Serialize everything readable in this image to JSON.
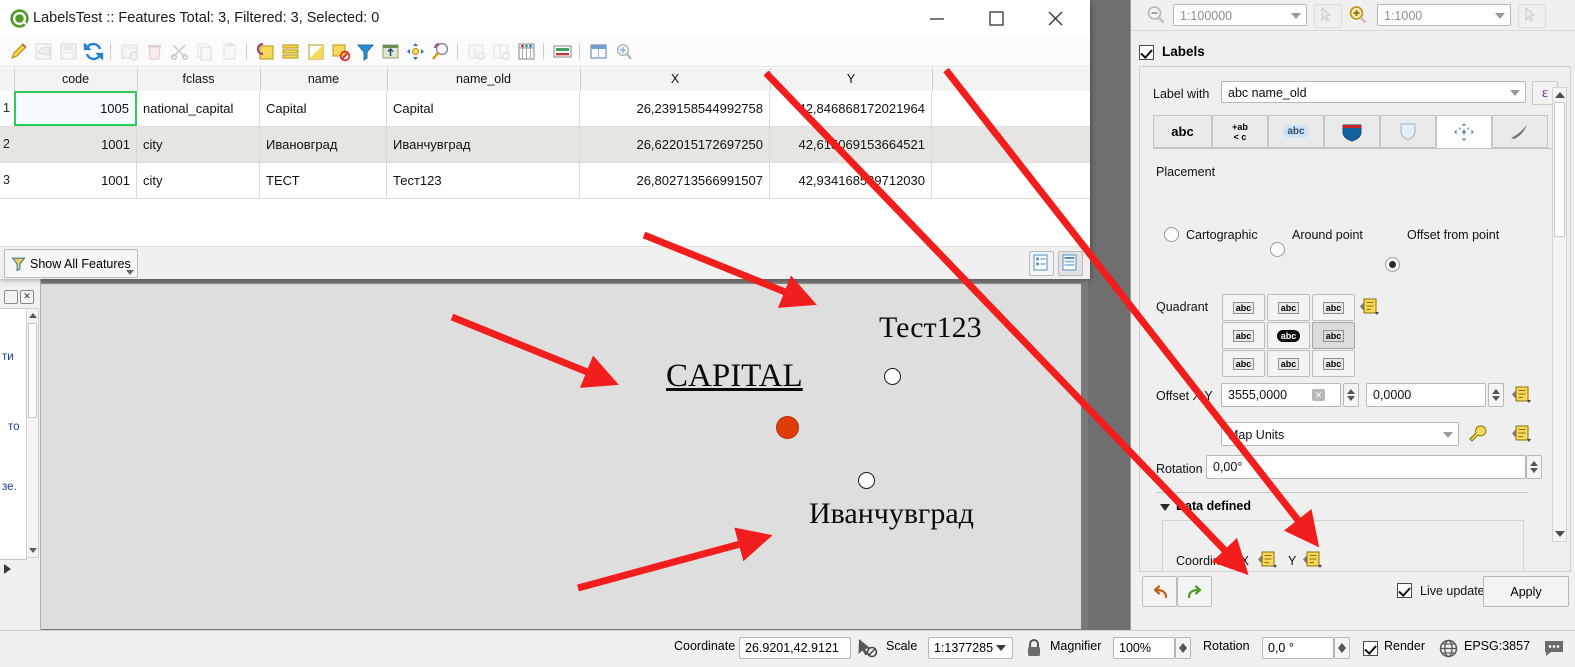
{
  "window": {
    "title": "LabelsTest :: Features Total: 3, Filtered: 3, Selected: 0",
    "minimize_label": "Minimize",
    "maximize_label": "Maximize",
    "close_label": "Close"
  },
  "attribute_toolbar": {
    "buttons": [
      {
        "name": "toggle-editing-icon",
        "title": "Toggle editing mode"
      },
      {
        "name": "save-edits-icon",
        "title": "Save edits"
      },
      {
        "name": "save-layer-edits-icon",
        "title": "Save layer edits"
      },
      {
        "name": "reload-table-icon",
        "title": "Reload the table"
      },
      {
        "name": "add-feature-icon",
        "title": "Add feature"
      },
      {
        "name": "delete-selected-icon",
        "title": "Delete selected features"
      },
      {
        "name": "cut-features-icon",
        "title": "Cut features"
      },
      {
        "name": "copy-features-icon",
        "title": "Copy features"
      },
      {
        "name": "paste-features-icon",
        "title": "Paste features"
      },
      {
        "name": "select-by-expression-icon",
        "title": "Select features using an expression"
      },
      {
        "name": "select-all-icon",
        "title": "Select all"
      },
      {
        "name": "invert-selection-icon",
        "title": "Invert selection"
      },
      {
        "name": "deselect-all-icon",
        "title": "Deselect all"
      },
      {
        "name": "filter-selection-icon",
        "title": "Filter / select using form"
      },
      {
        "name": "move-selection-to-top-icon",
        "title": "Move selection to top"
      },
      {
        "name": "pan-map-to-selected-icon",
        "title": "Pan map to selected rows"
      },
      {
        "name": "zoom-map-to-selected-icon",
        "title": "Zoom map to selected rows"
      },
      {
        "name": "new-field-icon",
        "title": "New field"
      },
      {
        "name": "delete-field-icon",
        "title": "Delete field"
      },
      {
        "name": "open-field-calculator-icon",
        "title": "Open field calculator"
      },
      {
        "name": "conditional-formatting-icon",
        "title": "Conditional formatting"
      },
      {
        "name": "organize-columns-icon",
        "title": "Organize columns"
      },
      {
        "name": "actions-icon",
        "title": "Actions"
      }
    ]
  },
  "table": {
    "columns": [
      "code",
      "fclass",
      "name",
      "name_old",
      "X",
      "Y"
    ],
    "rows": [
      {
        "num": "1",
        "code": "1005",
        "fclass": "national_capital",
        "name": "Capital",
        "name_old": "Capital",
        "X": "26,239158544992758",
        "Y": "42,846868172021964"
      },
      {
        "num": "2",
        "code": "1001",
        "fclass": "city",
        "name": "Ивановград",
        "name_old": "Иванчувград",
        "X": "26,622015172697250",
        "Y": "42,615069153664521"
      },
      {
        "num": "3",
        "code": "1001",
        "fclass": "city",
        "name": "ТЕСТ",
        "name_old": "Тест123",
        "X": "26,802713566991507",
        "Y": "42,934168589712030"
      }
    ]
  },
  "filter_bar": {
    "show_all_features_label": "Show All Features",
    "form_view_title": "Switch to form view",
    "table_view_title": "Switch to table view"
  },
  "map": {
    "background_color": "#dedede",
    "labels": [
      {
        "text": "Тест123",
        "name": "map-label-test123"
      },
      {
        "text": "CAPITAL",
        "name": "map-label-capital"
      },
      {
        "text": "Иванчувград",
        "name": "map-label-ivanchuvgrad"
      }
    ],
    "points": [
      {
        "name": "map-point-test123",
        "color": "#ffffff"
      },
      {
        "name": "map-point-capital",
        "color": "#e03c09"
      },
      {
        "name": "map-point-ivanchuvgrad",
        "color": "#ffffff"
      }
    ]
  },
  "scale_toolbar": {
    "zoom_out_scale": "1:100000",
    "zoom_in_scale": "1:1000"
  },
  "labels_panel": {
    "checkbox_label": "Labels",
    "label_with_caption": "Label with",
    "label_with_value": "abc  name_old",
    "expression_button": "ε",
    "style_tabs": [
      {
        "name": "tab-text",
        "glyph": "abc"
      },
      {
        "name": "tab-formatting",
        "glyph": "+ab"
      },
      {
        "name": "tab-buffer",
        "glyph": "abc"
      },
      {
        "name": "tab-background",
        "glyph": "shield"
      },
      {
        "name": "tab-shadow",
        "glyph": "shield-light"
      },
      {
        "name": "tab-placement",
        "glyph": "arrows"
      },
      {
        "name": "tab-rendering",
        "glyph": "brush"
      }
    ],
    "active_tab_index": 5,
    "placement_caption": "Placement",
    "placement_modes": [
      {
        "label": "Cartographic",
        "selected": false
      },
      {
        "label": "Around point",
        "selected": false
      },
      {
        "label": "Offset from point",
        "selected": true
      }
    ],
    "quadrant_caption": "Quadrant",
    "quadrant_selected_index": 5,
    "quadrant_glyph": "abc",
    "offset_caption": "Offset X,Y",
    "offset_x": "3555,0000",
    "offset_y": "0,0000",
    "units_value": "Map Units",
    "rotation_caption": "Rotation",
    "rotation_value": "0,00°",
    "data_defined_caption": "Data defined",
    "coordinate_caption": "Coordinate X",
    "coordinate_y_caption": "Y",
    "undo_title": "Undo",
    "redo_title": "Redo",
    "live_update_label": "Live update",
    "live_update_checked": true,
    "apply_label": "Apply"
  },
  "status_bar": {
    "coordinate_label": "Coordinate",
    "coordinate_value": "26.9201,42.9121",
    "toggle_extents_title": "Toggle extents and mouse position display",
    "scale_label": "Scale",
    "scale_value": "1:1377285",
    "lock_title": "Lock scale",
    "magnifier_label": "Magnifier",
    "magnifier_value": "100%",
    "rotation_label": "Rotation",
    "rotation_value": "0,0 °",
    "render_label": "Render",
    "render_checked": true,
    "crs_label": "EPSG:3857",
    "messages_title": "Messages"
  },
  "annotations": {
    "arrow_color": "#f21d1d",
    "arrow_count": 5
  },
  "left_dock_fragment": {
    "text_fragments": [
      "ти",
      "то",
      "зе."
    ]
  }
}
